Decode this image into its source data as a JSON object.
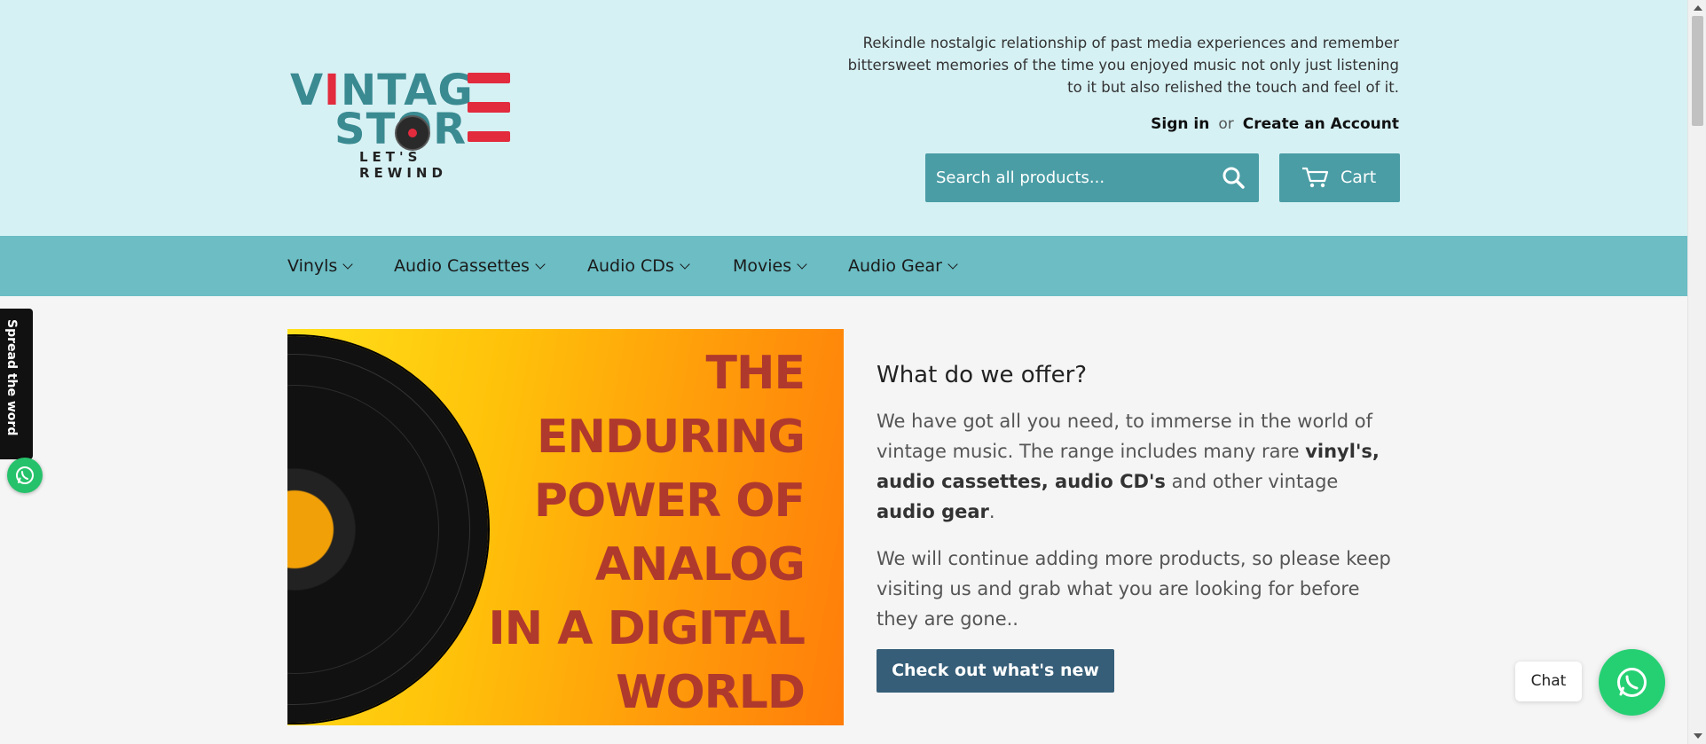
{
  "header": {
    "logo": {
      "line1_a": "V",
      "line1_b": "I",
      "line1_c": "NTAG",
      "line2": "STOR",
      "tagline": "LET'S REWIND",
      "alt": "Vintage Store"
    },
    "tagline": "Rekindle nostalgic relationship of past media experiences and remember bittersweet memories of the time you enjoyed music not only just listening to it but also relished the touch and feel of it.",
    "account": {
      "sign_in": "Sign in",
      "or": "or",
      "create_account": "Create an Account"
    },
    "search": {
      "placeholder": "Search all products...",
      "icon": "search-icon"
    },
    "cart": {
      "label": "Cart",
      "icon": "cart-icon"
    }
  },
  "nav": {
    "items": [
      {
        "label": "Vinyls"
      },
      {
        "label": "Audio Cassettes"
      },
      {
        "label": "Audio CDs"
      },
      {
        "label": "Movies"
      },
      {
        "label": "Audio Gear"
      }
    ]
  },
  "hero": {
    "image_text": [
      "THE",
      "ENDURING",
      "POWER OF",
      "ANALOG",
      "IN A DIGITAL",
      "WORLD"
    ]
  },
  "offer": {
    "heading": "What do we offer?",
    "p1_a": "We have got all you need, to immerse in the world of vintage music. The range includes many rare ",
    "p1_b": "vinyl's, audio cassettes, audio CD's",
    "p1_c": " and other vintage ",
    "p1_d": "audio gear",
    "p1_e": ".",
    "p2": "We will continue adding more products, so please keep visiting us and grab what you are looking for before they are gone..",
    "cta": "Check out what's new"
  },
  "widgets": {
    "spread_label": "Spread the word",
    "chat_label": "Chat"
  },
  "colors": {
    "header_bg": "#d6f1f4",
    "nav_bg": "#6cbdc4",
    "button_teal": "#4a9da5",
    "cta_bg": "#365e78",
    "whatsapp": "#25d073"
  }
}
